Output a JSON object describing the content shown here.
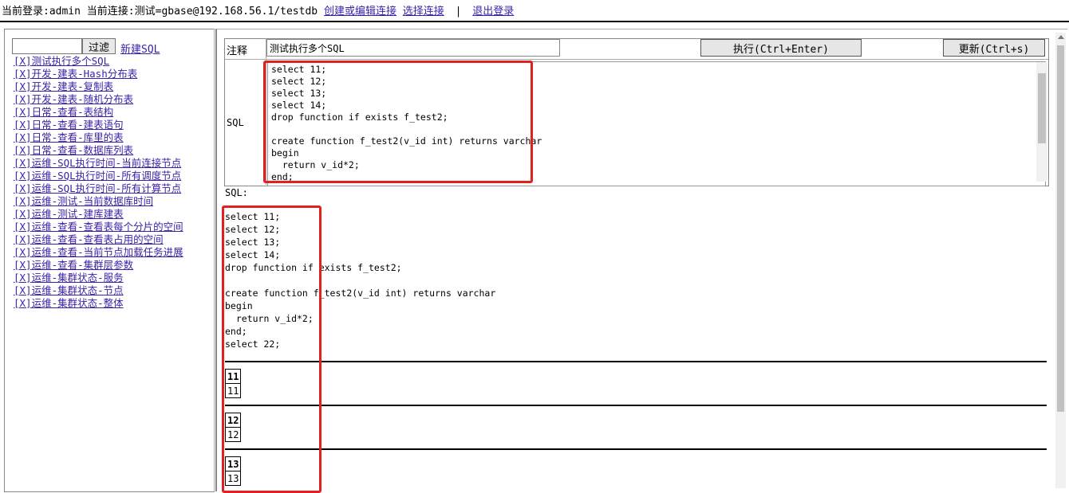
{
  "header": {
    "login_text": "当前登录:admin 当前连接:测试=gbase@192.168.56.1/testdb",
    "create_edit_link": "创建或编辑连接",
    "select_link": "选择连接",
    "separator": "|",
    "logout_link": "退出登录"
  },
  "sidebar": {
    "filter_placeholder": "",
    "filter_button": "过滤",
    "new_sql_link": "新建SQL",
    "delete_marker": "[X]",
    "items": [
      "测试执行多个SQL",
      "开发-建表-Hash分布表",
      "开发-建表-复制表",
      "开发-建表-随机分布表",
      "日常-查看-表结构",
      "日常-查看-建表语句",
      "日常-查看-库里的表",
      "日常-查看-数据库列表",
      "运维-SQL执行时间-当前连接节点",
      "运维-SQL执行时间-所有调度节点",
      "运维-SQL执行时间-所有计算节点",
      "运维-测试-当前数据库时间",
      "运维-测试-建库建表",
      "运维-查看-查看表每个分片的空间",
      "运维-查看-查看表占用的空间",
      "运维-查看-当前节点加载任务进展",
      "运维-查看-集群层参数",
      "运维-集群状态-服务",
      "运维-集群状态-节点",
      "运维-集群状态-整体"
    ]
  },
  "editor": {
    "comment_label": "注释",
    "comment_value": "测试执行多个SQL",
    "execute_button": "执行(Ctrl+Enter)",
    "update_button": "更新(Ctrl+s)",
    "sql_label": "SQL",
    "sql_text": "select 11;\nselect 12;\nselect 13;\nselect 14;\ndrop function if exists f_test2;\n\ncreate function f_test2(v_id int) returns varchar\nbegin\n  return v_id*2;\nend;"
  },
  "result": {
    "sql_label": "SQL:",
    "sql_echo": "select 11;\nselect 12;\nselect 13;\nselect 14;\ndrop function if exists f_test2;\n\ncreate function f_test2(v_id int) returns varchar\nbegin\n  return v_id*2;\nend;\nselect 22;",
    "blocks": [
      {
        "header": "11",
        "value": "11"
      },
      {
        "header": "12",
        "value": "12"
      },
      {
        "header": "13",
        "value": "13"
      }
    ]
  },
  "colors": {
    "link": "#3a1fa8",
    "highlight_box": "#e0221f"
  }
}
